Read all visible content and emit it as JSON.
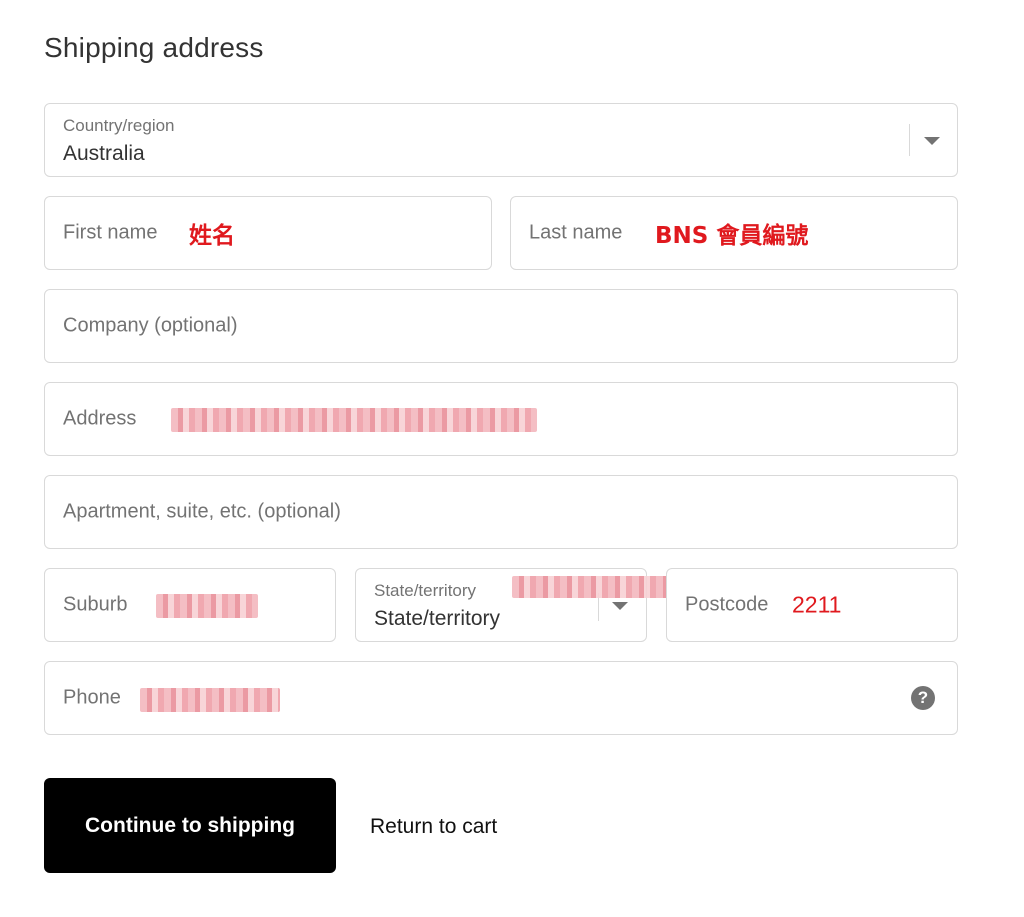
{
  "section_title": "Shipping address",
  "country": {
    "label": "Country/region",
    "value": "Australia"
  },
  "first_name": {
    "placeholder": "First name",
    "annotation": "姓名"
  },
  "last_name": {
    "placeholder": "Last name",
    "annotation": "BNS 會員編號"
  },
  "company": {
    "placeholder": "Company (optional)"
  },
  "address": {
    "placeholder": "Address"
  },
  "apartment": {
    "placeholder": "Apartment, suite, etc. (optional)"
  },
  "suburb": {
    "placeholder": "Suburb"
  },
  "state": {
    "label": "State/territory",
    "value": "State/territory"
  },
  "postcode": {
    "placeholder": "Postcode",
    "annotation": "2211"
  },
  "phone": {
    "placeholder": "Phone",
    "help_icon": "question-circle-icon",
    "help_glyph": "?"
  },
  "actions": {
    "continue_label": "Continue to shipping",
    "return_label": "Return to cart"
  },
  "colors": {
    "annotation": "#e0191e",
    "button_bg": "#000000",
    "border": "#d9d9d9"
  }
}
